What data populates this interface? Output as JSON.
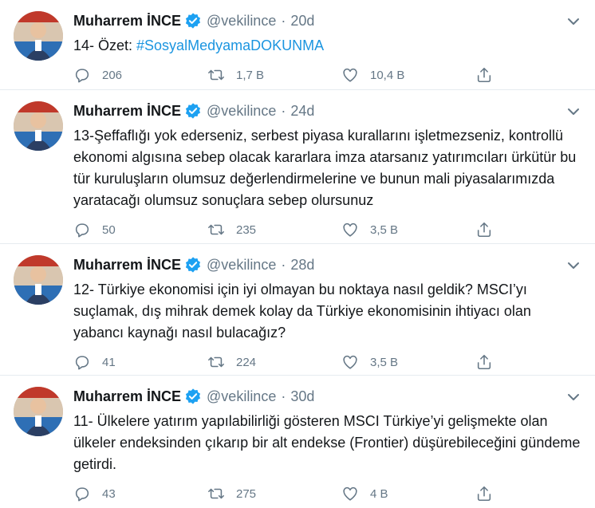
{
  "colors": {
    "link": "#1b95e0",
    "muted": "#657786",
    "verified": "#1da1f2",
    "divider": "#e6ecf0"
  },
  "tweets": [
    {
      "name": "Muharrem İNCE",
      "handle": "@vekilince",
      "separator": "·",
      "time": "20d",
      "text": "14- Özet: ",
      "hashtag": "#SosyalMedyamaDOKUNMA",
      "replies": "206",
      "retweets": "1,7 B",
      "likes": "10,4 B"
    },
    {
      "name": "Muharrem İNCE",
      "handle": "@vekilince",
      "separator": "·",
      "time": "24d",
      "text": "13-Şeffaflığı yok ederseniz, serbest piyasa kurallarını işletmezseniz, kontrollü ekonomi algısına sebep olacak kararlara imza atarsanız yatırımcıları ürkütür bu tür kuruluşların olumsuz değerlendirmelerine ve bunun mali piyasalarımızda yaratacağı olumsuz sonuçlara sebep olursunuz",
      "hashtag": "",
      "replies": "50",
      "retweets": "235",
      "likes": "3,5 B"
    },
    {
      "name": "Muharrem İNCE",
      "handle": "@vekilince",
      "separator": "·",
      "time": "28d",
      "text": "12- Türkiye ekonomisi için iyi olmayan bu noktaya nasıl geldik? MSCI’yı suçlamak, dış mihrak demek kolay da Türkiye ekonomisinin ihtiyacı olan yabancı kaynağı nasıl bulacağız?",
      "hashtag": "",
      "replies": "41",
      "retweets": "224",
      "likes": "3,5 B"
    },
    {
      "name": "Muharrem İNCE",
      "handle": "@vekilince",
      "separator": "·",
      "time": "30d",
      "text": "11- Ülkelere yatırım yapılabilirliği gösteren MSCI Türkiye’yi gelişmekte olan ülkeler endeksinden çıkarıp bir alt endekse (Frontier) düşürebileceğini gündeme getirdi.",
      "hashtag": "",
      "replies": "43",
      "retweets": "275",
      "likes": "4 B"
    }
  ]
}
